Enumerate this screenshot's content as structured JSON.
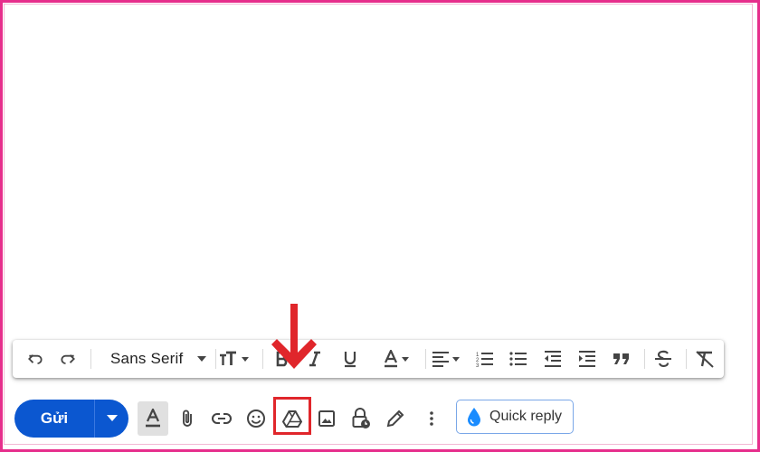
{
  "send": {
    "label": "Gửi"
  },
  "format_bar": {
    "font_family": "Sans Serif"
  },
  "quick_reply": {
    "label": "Quick reply"
  },
  "colors": {
    "frame": "#e62e8c",
    "send_button": "#0b57d0",
    "highlight": "#e0262b",
    "quick_reply_border": "#7aa7e8",
    "quick_reply_icon": "#1a8cff"
  },
  "icons": {
    "format_bar": [
      "undo-icon",
      "redo-icon",
      "font-family-select",
      "text-size-icon",
      "bold-icon",
      "italic-icon",
      "underline-icon",
      "text-color-icon",
      "align-icon",
      "numbered-list-icon",
      "bulleted-list-icon",
      "indent-less-icon",
      "indent-more-icon",
      "quote-icon",
      "strikethrough-icon",
      "remove-formatting-icon"
    ],
    "bottom_toolbar": [
      "formatting-options-icon",
      "attach-file-icon",
      "insert-link-icon",
      "insert-emoji-icon",
      "google-drive-icon",
      "insert-photo-icon",
      "confidential-mode-icon",
      "signature-icon",
      "more-options-icon"
    ]
  }
}
